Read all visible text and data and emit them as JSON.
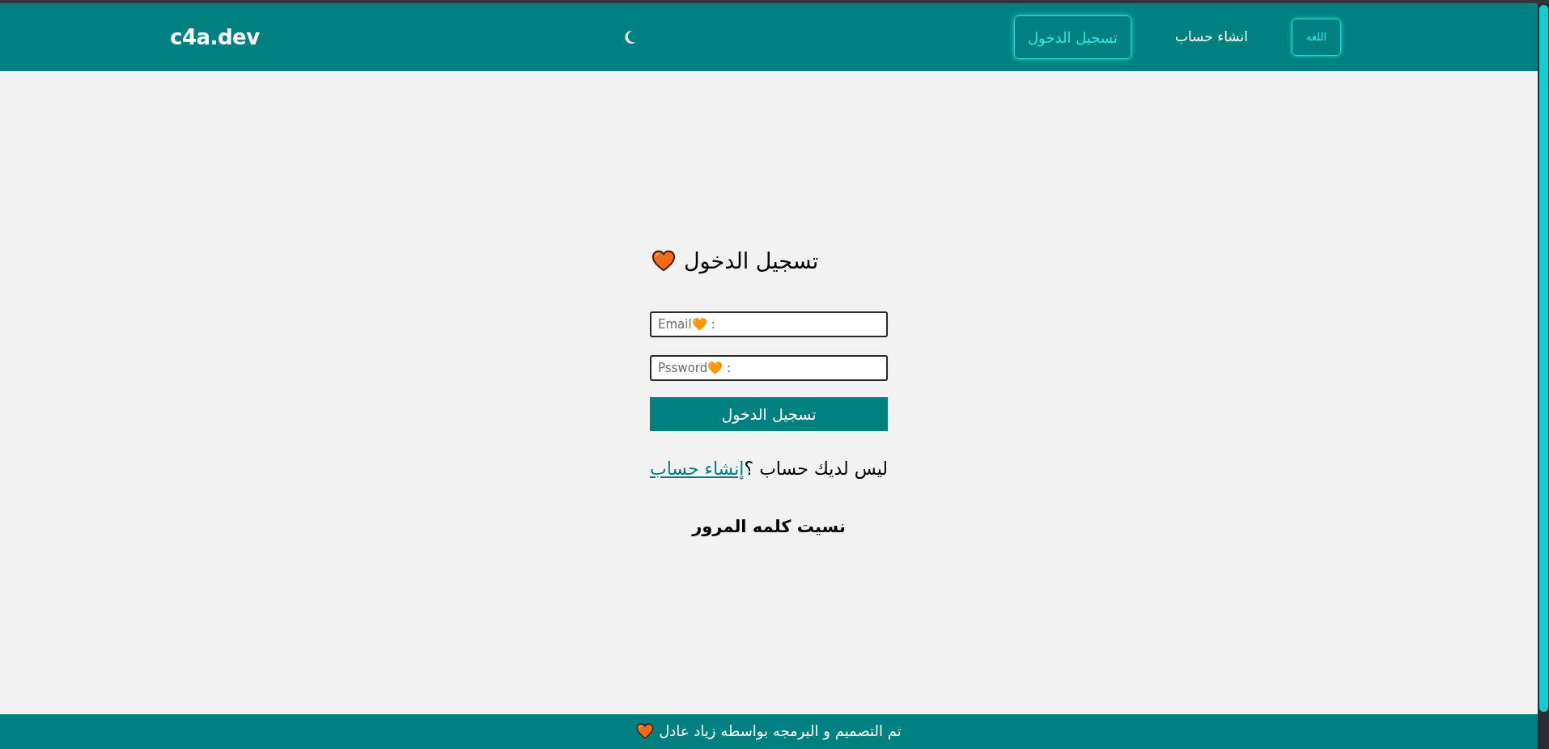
{
  "header": {
    "nav": [
      {
        "kind": "compact",
        "label": "اللغه"
      },
      {
        "kind": "link",
        "label": "انشاء حساب"
      },
      {
        "kind": "button",
        "label": "تسجيل الدخول"
      }
    ],
    "logo": "c4a.dev"
  },
  "login": {
    "heading": "تسجيل الدخول",
    "email_field": {
      "placeholder": "Email🧡 :"
    },
    "password_field": {
      "placeholder": "Pssword🧡 :"
    },
    "submit": "تسجيل الدخول",
    "signup_prompt": {
      "text": "ليس لديك حساب ؟",
      "link": "إنشاء حساب"
    },
    "forgot_password": "نسيت كلمه المرور"
  },
  "footer": {
    "text": "تم التصميم و البرمجه بواسطه زياد عادل"
  }
}
